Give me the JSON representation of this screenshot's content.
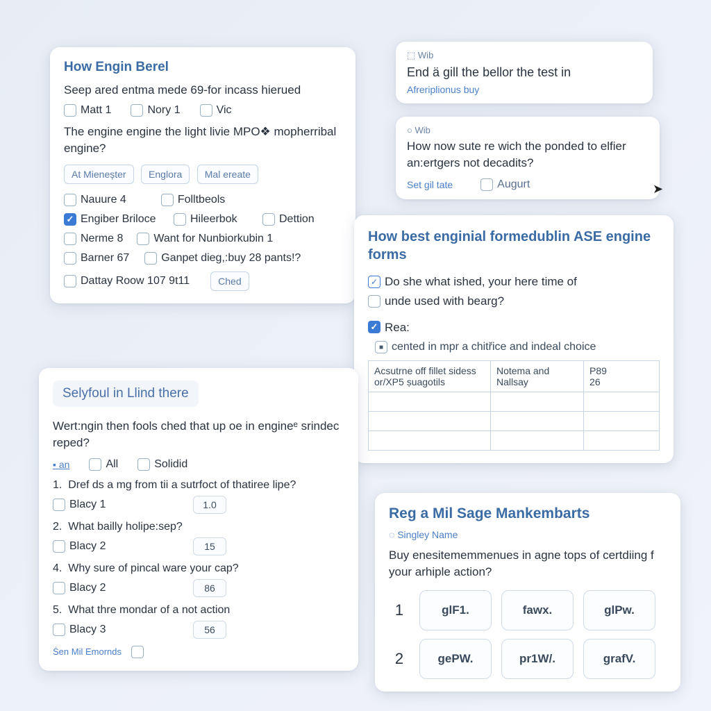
{
  "card1": {
    "title": "How Engin Berel",
    "subtitle": "Seep ared entma mede 69-for incass hierued",
    "row1": [
      "Matt 1",
      "Nory 1",
      "Vic"
    ],
    "question": "The engine engine the light livie MPO❖ mopherribal engine?",
    "buttons": [
      "At Mieneșter",
      "Englora",
      "Mal ereate"
    ],
    "checks": [
      {
        "label": "Nauure 4",
        "checked": false
      },
      {
        "label": "Folltbeols",
        "checked": false
      },
      {
        "label": "Engiber Briloce",
        "checked": true
      },
      {
        "label": "Hileerbok",
        "checked": false
      },
      {
        "label": "Dettion",
        "checked": false
      },
      {
        "label": "Nerme 8",
        "checked": false
      },
      {
        "label": "Want for Nunbiorkubin 1",
        "checked": false
      },
      {
        "label": "Barner 67",
        "checked": false
      },
      {
        "label": "Ganpet dieg,:buy 28 pants!?",
        "checked": false
      },
      {
        "label": "Dattay Roow 107 9t11",
        "checked": false
      }
    ],
    "chedBtn": "Ched"
  },
  "card2": {
    "badge": "Wib",
    "text": "End ä gill the bellor the test in",
    "sub": "Afreriplionus buy"
  },
  "card3": {
    "badge": "Wib",
    "text": "How now sute re wich the ponded to elfier an:ertgers not decadits?",
    "subL": "Set gil tate",
    "subR": "Augurt"
  },
  "card4": {
    "tab": "Selyfoul in Llind there",
    "question": "Wert:ngin then fools ched that up oe in engineᵉ srindeс reped?",
    "top": {
      "link": "an",
      "opts": [
        "All",
        "Solidid"
      ]
    },
    "rows": [
      {
        "num": "1.",
        "q": "Dref ds a mg from tii a sutrfoct of thatiree lipe?"
      },
      {
        "num": "2.",
        "q": "What bailly holipе:sep?"
      },
      {
        "num": "4.",
        "q": "Why sure of pincal ware your cap?"
      },
      {
        "num": "5.",
        "q": "What thre mondar of a not action"
      }
    ],
    "choices": [
      {
        "label": "Blacy 1",
        "val": "1.0"
      },
      {
        "label": "Blacy 2",
        "val": "15"
      },
      {
        "label": "Blacy 2",
        "val": "86"
      },
      {
        "label": "Blacy 3",
        "val": "56"
      }
    ],
    "footer": "Ṡen Mil Emornds"
  },
  "card5": {
    "title": "How best enginial formedublin ASE engine forms",
    "q1": "Do she what ished, your here time of",
    "q2": "unde used with bearg?",
    "rea": "Rea:",
    "desc": "cented in mpr a chitřice and indeal choice",
    "table": [
      [
        "Acsutrne off fillet sidess or/XP5 ṣuagotils",
        "Notema and Nallsay",
        "P89\n26"
      ]
    ]
  },
  "card6": {
    "title": "Reg a Mil Sage Mankembarts",
    "sub": "Singley Name",
    "text": "Buy enesitememmenues in agne tops of certdiing f your arhiple action?",
    "rows": [
      {
        "num": "1",
        "tiles": [
          "glF1.",
          "fawx.",
          "glPw."
        ]
      },
      {
        "num": "2",
        "tiles": [
          "gePW.",
          "pr1W/.",
          "grafV."
        ]
      }
    ]
  }
}
